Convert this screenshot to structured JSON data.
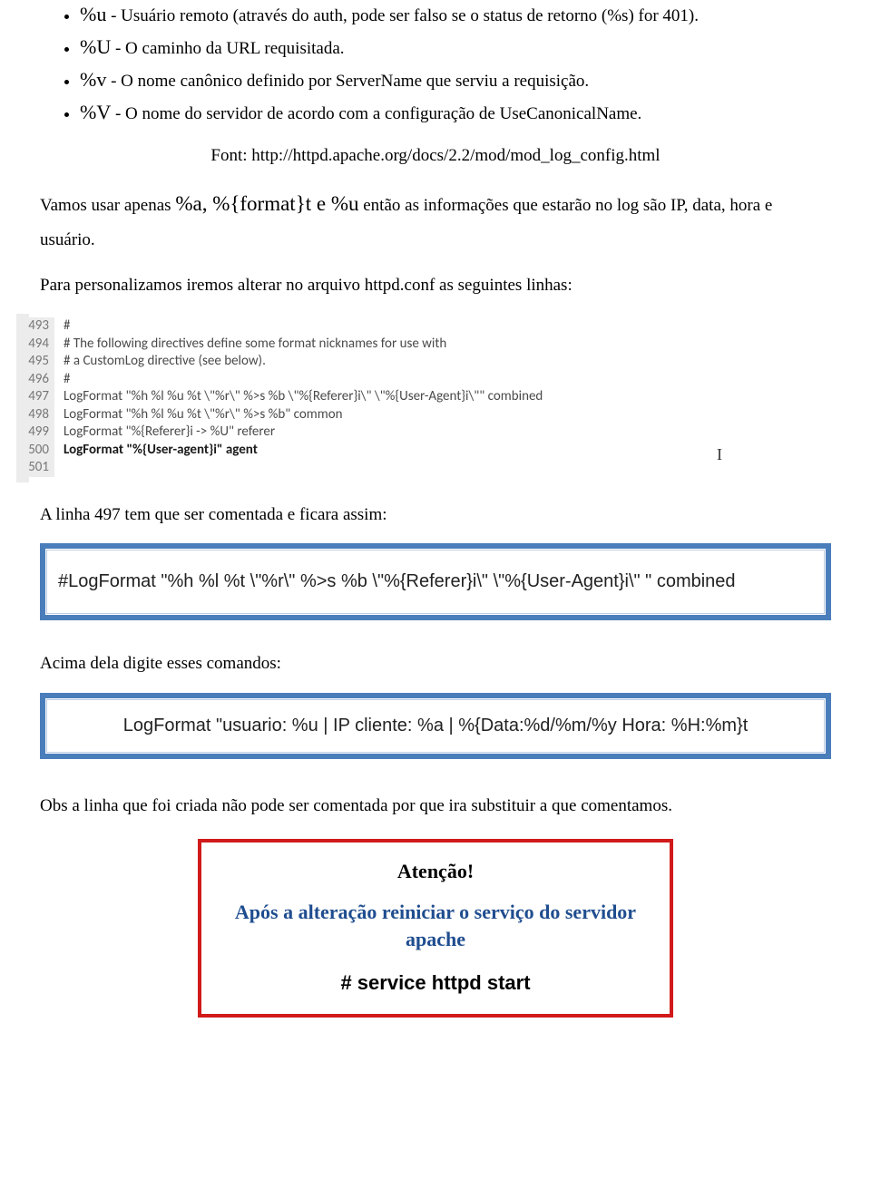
{
  "bullets": {
    "b1_var": "%u",
    "b1_rest": " - Usuário remoto (através do auth, pode ser falso se o status de retorno (%s) for 401).",
    "b2_var": "%U",
    "b2_rest": " - O caminho da URL requisitada.",
    "b3_var": "%v",
    "b3_rest": " - O nome canônico definido por ServerName que serviu a requisição.",
    "b4_var": "%V",
    "b4_rest": " - O nome do servidor de acordo com a configuração de UseCanonicalName."
  },
  "font_line": "Font: http://httpd.apache.org/docs/2.2/mod/mod_log_config.html",
  "para1_a": "Vamos usar apenas ",
  "para1_vars": "%a, %{format}t e %u",
  "para1_b": " então as informações que estarão no log são IP, data, hora e usuário.",
  "para2": "Para personalizamos iremos alterar no arquivo httpd.conf as seguintes linhas:",
  "code": {
    "lines": [
      {
        "n": "493",
        "t": "#",
        "bold": false
      },
      {
        "n": "494",
        "t": "# The following directives define some format nicknames for use with",
        "bold": false
      },
      {
        "n": "495",
        "t": "# a CustomLog directive (see below).",
        "bold": false
      },
      {
        "n": "496",
        "t": "#",
        "bold": false
      },
      {
        "n": "497",
        "t": "LogFormat \"%h %l %u %t \\\"%r\\\" %>s %b \\\"%{Referer}i\\\" \\\"%{User-Agent}i\\\"\" combined",
        "bold": false
      },
      {
        "n": "498",
        "t": "LogFormat \"%h %l %u %t \\\"%r\\\" %>s %b\" common",
        "bold": false
      },
      {
        "n": "499",
        "t": "LogFormat \"%{Referer}i -> %U\" referer",
        "bold": false
      },
      {
        "n": "500",
        "t": "LogFormat \"%{User-agent}i\" agent",
        "bold": true
      },
      {
        "n": "501",
        "t": "",
        "bold": false
      }
    ]
  },
  "line_after_code": "A linha 497 tem que ser comentada e ficara assim:",
  "bluebox1": "#LogFormat \"%h %l %t \\\"%r\\\" %>s %b \\\"%{Referer}i\\\" \\\"%{User-Agent}i\\\" \" combined",
  "above_cmds": "Acima dela digite esses comandos:",
  "bluebox2": "LogFormat \"usuario: %u | IP cliente: %a | %{Data:%d/%m/%y Hora: %H:%m}t",
  "obs": "Obs a linha que foi criada não pode ser comentada por que ira substituir a que comentamos.",
  "redbox": {
    "title": "Atenção!",
    "line2": "Após a alteração reiniciar o serviço do servidor apache",
    "cmd": "# service httpd start"
  }
}
